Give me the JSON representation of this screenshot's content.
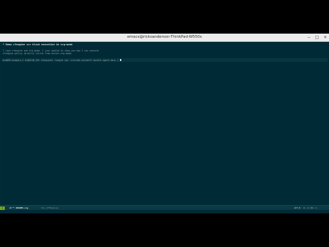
{
  "window": {
    "title": "emacs@ricksanderson-ThinkPad-W550s",
    "minimize_glyph": "−",
    "maximize_glyph": "□",
    "close_glyph": "✕"
  },
  "buffer": {
    "heading": "* Demo cfengine src block execution in org-mode",
    "para_1": "I love cfengine and org-mode, I just wanted to show you how I can execute",
    "para_2": "cfengine policy directly inline from within org-mode.",
    "src_line": "#+NAME:example_1 #+BEGIN_SRC cfengine3 :tangle yes :include-vardefs? bundle agent main { ",
    "gutter_marks": [
      "·",
      "·",
      "·",
      "·",
      "·",
      "·",
      "·",
      "·",
      "·",
      "·",
      "·",
      "·",
      "·",
      "·",
      "·",
      "·",
      "·",
      "·",
      "·",
      "·",
      "·",
      "·",
      "·",
      "·",
      "·",
      "·",
      "·",
      "·",
      "·",
      "·",
      "·",
      "·",
      "·",
      "·",
      "·",
      "·",
      "·",
      "·",
      "·",
      "·",
      "·",
      "·",
      "·",
      "·",
      "·",
      "·",
      "·",
      "·",
      "·",
      "·",
      "·"
    ]
  },
  "modeline": {
    "window_number": "1",
    "buffer_name": "U:** README.org",
    "mode": "Org [CFEngine]",
    "encoding": "utf-8",
    "position": "1% (3,90) 4"
  },
  "colors": {
    "background": "#002b36",
    "modeline_bg": "#0a3a46",
    "accent_green": "#79a81a"
  }
}
